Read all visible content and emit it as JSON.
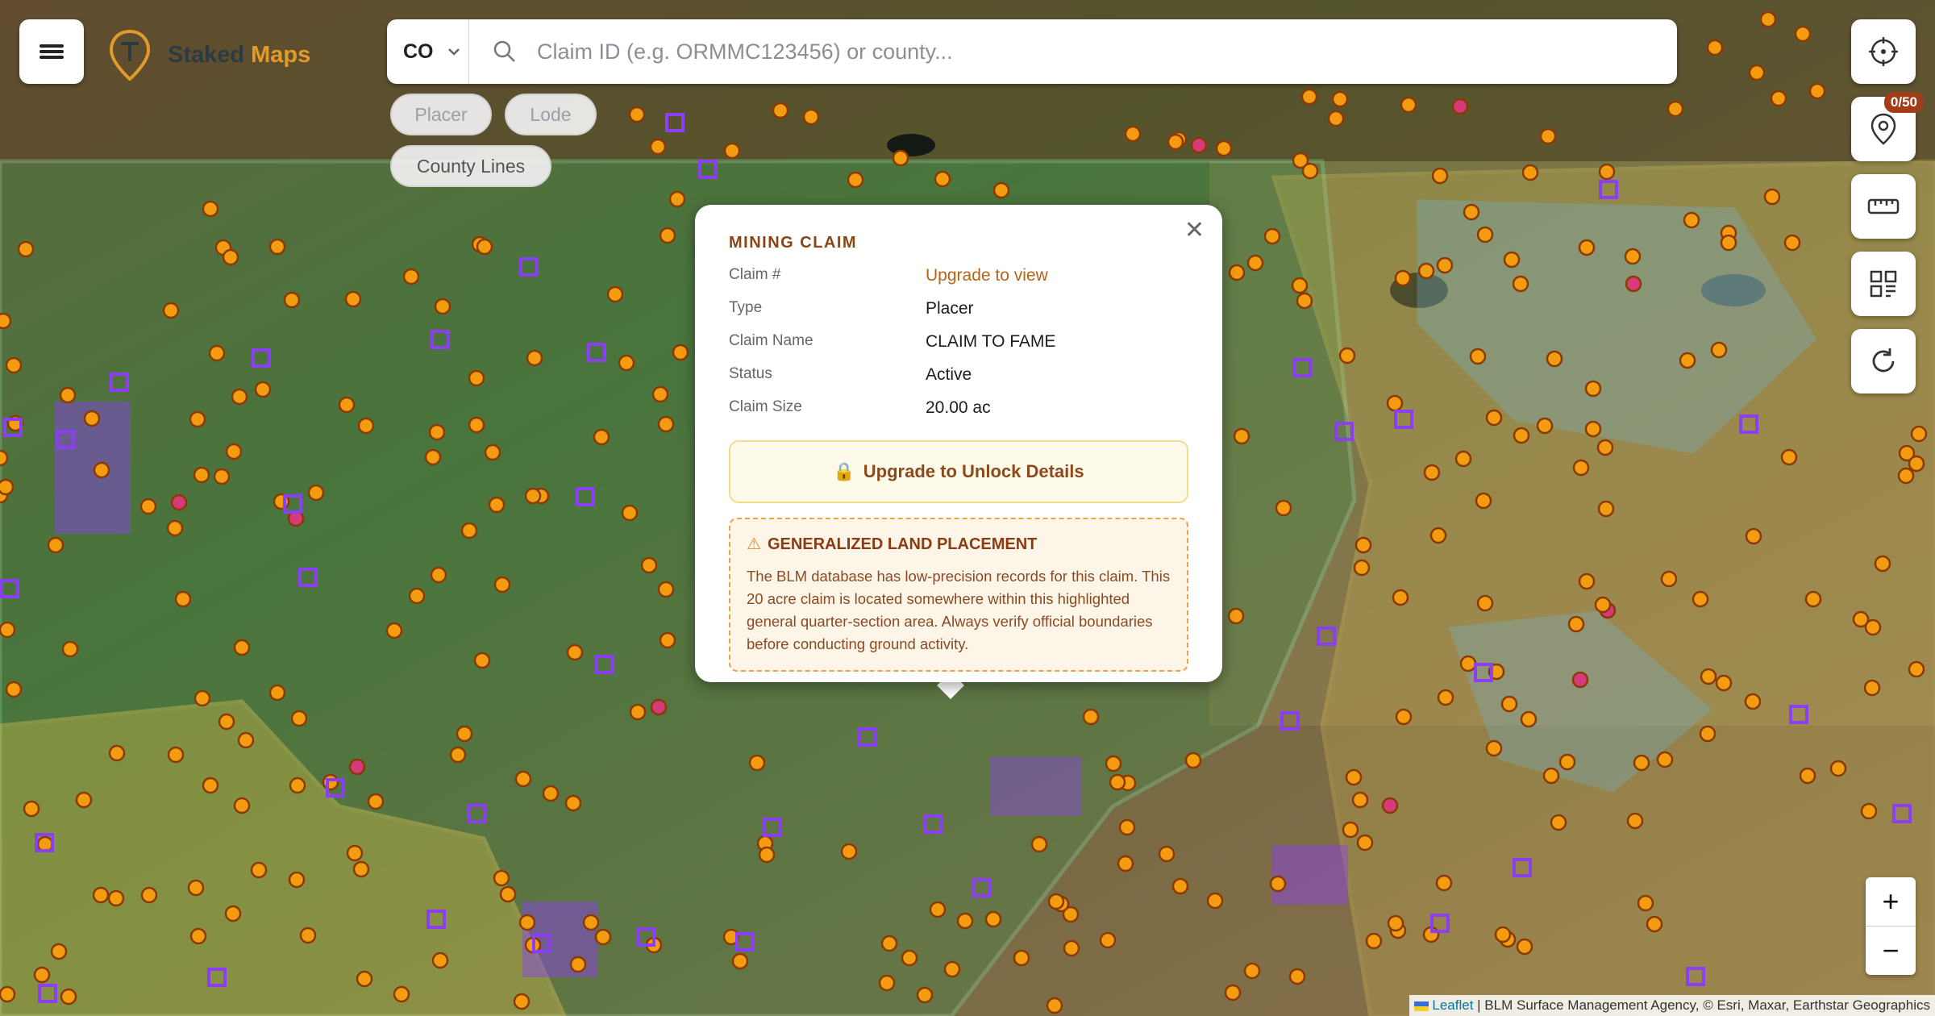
{
  "app": {
    "brand_a": "Staked",
    "brand_b": "Maps"
  },
  "search": {
    "state": "CO",
    "placeholder": "Claim ID (e.g. ORMMC123456) or county..."
  },
  "filters": {
    "placer": "Placer",
    "lode": "Lode",
    "county_lines": "County Lines"
  },
  "tools": {
    "claims_counter": "0/50"
  },
  "zoom": {
    "in": "+",
    "out": "−"
  },
  "attribution": {
    "leaflet": "Leaflet",
    "rest": "| BLM Surface Management Agency, © Esri, Maxar, Earthstar Geographics"
  },
  "popup": {
    "title": "MINING CLAIM",
    "rows": [
      {
        "k": "Claim #",
        "v": "Upgrade to view"
      },
      {
        "k": "Type",
        "v": "Placer"
      },
      {
        "k": "Claim Name",
        "v": "CLAIM TO FAME"
      },
      {
        "k": "Status",
        "v": "Active"
      },
      {
        "k": "Claim Size",
        "v": "20.00 ac"
      }
    ],
    "unlock_label": "Upgrade to Unlock Details",
    "warning_title": "GENERALIZED LAND PLACEMENT",
    "warning_text": "The BLM database has low-precision records for this claim. This 20 acre claim is located somewhere within this highlighted general quarter-section area. Always verify official boundaries before conducting ground activity."
  },
  "colors": {
    "accent": "#e09b2a",
    "placer_marker": "#f39c12",
    "lode_marker": "#d63a7a",
    "claim_box": "#8a3ff2",
    "blm_green": "#7fd39a",
    "blm_yellow": "#f0d25a",
    "blm_blue": "#6fb6d8"
  },
  "icons": {
    "menu": "hamburger-icon",
    "search": "search-icon",
    "locate": "crosshair-icon",
    "pin": "map-pin-icon",
    "ruler": "ruler-icon",
    "layers": "grid-icon",
    "refresh": "refresh-icon",
    "close": "close-icon",
    "lock": "lock-icon",
    "warning": "warning-icon"
  }
}
